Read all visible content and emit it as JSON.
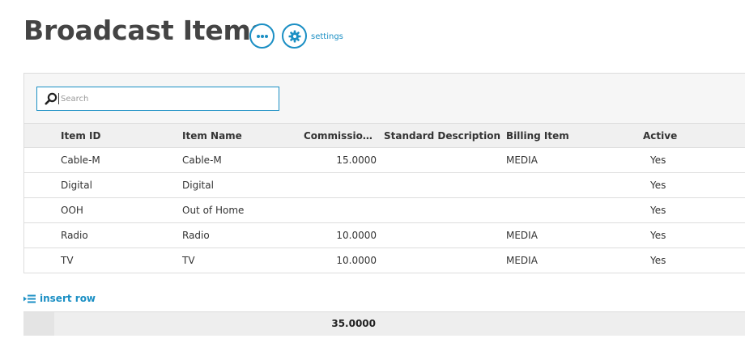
{
  "page": {
    "title": "Broadcast Items",
    "settings_label": "settings"
  },
  "search": {
    "placeholder": "Search",
    "value": ""
  },
  "columns": [
    {
      "key": "item_id",
      "label": "Item ID"
    },
    {
      "key": "item_name",
      "label": "Item Name"
    },
    {
      "key": "commission",
      "label": "Commission/..."
    },
    {
      "key": "standard_description",
      "label": "Standard Description"
    },
    {
      "key": "billing_item",
      "label": "Billing Item"
    },
    {
      "key": "active",
      "label": "Active"
    }
  ],
  "rows": [
    {
      "item_id": "Cable-M",
      "item_name": "Cable-M",
      "commission": "15.0000",
      "standard_description": "",
      "billing_item": "MEDIA",
      "active": "Yes"
    },
    {
      "item_id": "Digital",
      "item_name": "Digital",
      "commission": "",
      "standard_description": "",
      "billing_item": "",
      "active": "Yes"
    },
    {
      "item_id": "OOH",
      "item_name": "Out of Home",
      "commission": "",
      "standard_description": "",
      "billing_item": "",
      "active": "Yes"
    },
    {
      "item_id": "Radio",
      "item_name": "Radio",
      "commission": "10.0000",
      "standard_description": "",
      "billing_item": "MEDIA",
      "active": "Yes"
    },
    {
      "item_id": "TV",
      "item_name": "TV",
      "commission": "10.0000",
      "standard_description": "",
      "billing_item": "MEDIA",
      "active": "Yes"
    }
  ],
  "actions": {
    "insert_row_label": "insert row"
  },
  "totals": {
    "commission": "35.0000"
  },
  "icons": {
    "more": "more-options-icon",
    "settings": "gear-icon",
    "search": "search-icon",
    "insert_row": "insert-row-icon"
  },
  "colors": {
    "accent": "#1b8fc4",
    "title": "#444444",
    "header_bg": "#f0f0f0",
    "total_bg": "#eeeeee"
  }
}
